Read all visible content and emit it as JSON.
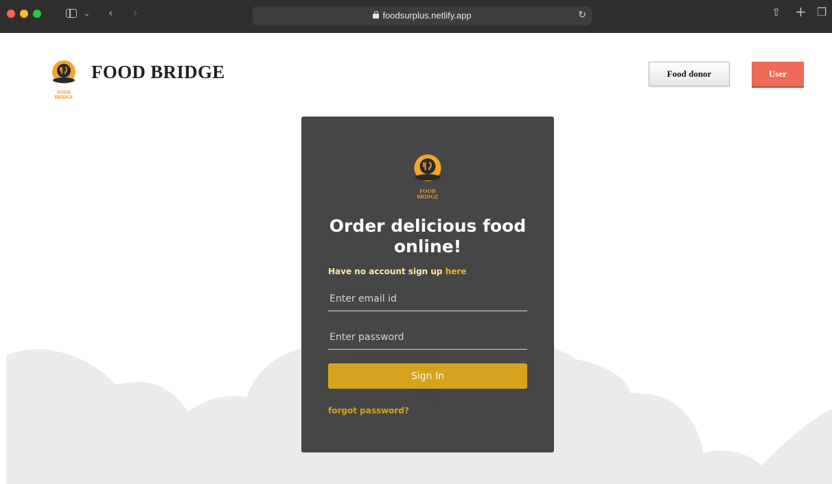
{
  "browser": {
    "url": "foodsurplus.netlify.app"
  },
  "header": {
    "brand_name": "FOOD BRIDGE",
    "logo_text_top": "FOOD",
    "logo_text_bottom": "BRIDGE",
    "food_donor_label": "Food donor",
    "user_label": "User"
  },
  "login": {
    "headline": "Order delicious food online!",
    "signup_text": "Have no account sign up",
    "signup_link": "here",
    "email_placeholder": "Enter email id",
    "password_placeholder": "Enter password",
    "signin_label": "Sign In",
    "forgot_label": "forgot password?"
  },
  "colors": {
    "accent": "#d6a31c",
    "user_button": "#ee6a56",
    "card": "#3e3e3e"
  }
}
